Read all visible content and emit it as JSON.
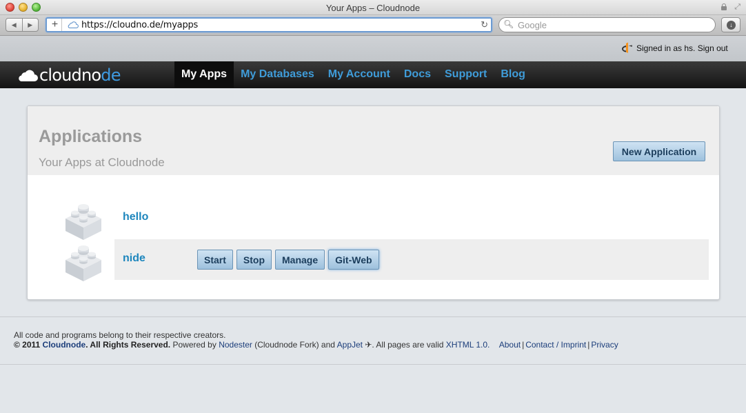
{
  "browser": {
    "window_title": "Your Apps – Cloudnode",
    "url": "https://cloudno.de/myapps",
    "search_placeholder": "Google"
  },
  "userbar": {
    "signed_in_text": "Signed in as hs. Sign out"
  },
  "site": {
    "logo_prefix": "cloudno",
    "logo_highlight": "de",
    "nav": [
      {
        "label": "My Apps",
        "active": true
      },
      {
        "label": "My Databases"
      },
      {
        "label": "My Account"
      },
      {
        "label": "Docs"
      },
      {
        "label": "Support"
      },
      {
        "label": "Blog"
      }
    ]
  },
  "panel": {
    "title": "Applications",
    "subtitle": "Your Apps at Cloudnode",
    "new_button": "New Application",
    "apps": [
      {
        "name": "hello"
      },
      {
        "name": "nide",
        "buttons": [
          "Start",
          "Stop",
          "Manage",
          "Git-Web"
        ]
      }
    ]
  },
  "footer": {
    "line1": "All code and programs belong to their respective creators.",
    "copyright_prefix": "© 2011 ",
    "copyright_brand": "Cloudnode",
    "copyright_suffix": ". All Rights Reserved.",
    "powered_by": " Powered by ",
    "nodester": "Nodester",
    "fork_text": " (Cloudnode Fork) and ",
    "appjet": "AppJet",
    "appjet_glyph": " ✈",
    "valid_text": ". All pages are valid ",
    "xhtml": "XHTML 1.0.",
    "about": "About",
    "contact": "Contact / Imprint",
    "privacy": "Privacy"
  },
  "colors": {
    "accent_blue": "#3f9cd9",
    "link_blue": "#1d86bd",
    "nav_dark": "#141414"
  }
}
